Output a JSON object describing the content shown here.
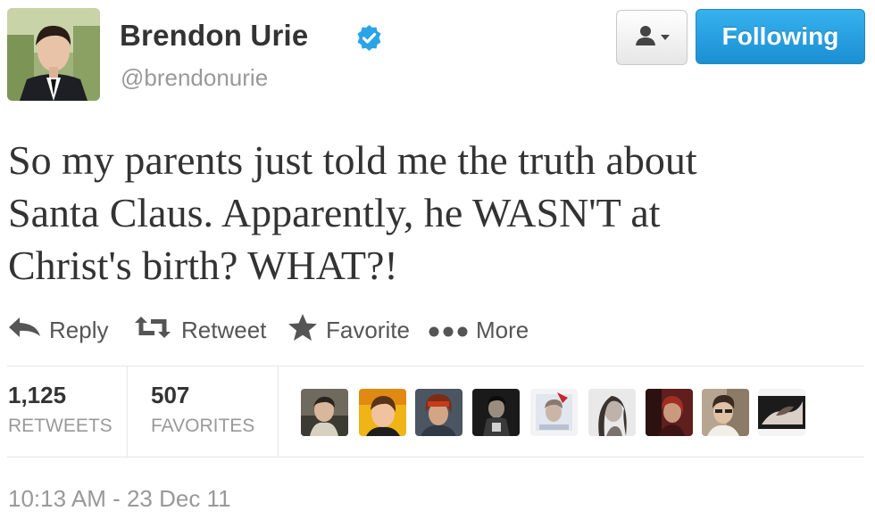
{
  "user": {
    "name": "Brendon Urie",
    "handle": "@brendonurie"
  },
  "buttons": {
    "follow_label": "Following"
  },
  "tweet": {
    "lines": [
      "So my parents just told me the truth about",
      "Santa Claus. Apparently, he WASN'T at",
      "Christ's birth? WHAT?!"
    ]
  },
  "actions": {
    "reply": "Reply",
    "retweet": "Retweet",
    "favorite": "Favorite",
    "more": "More"
  },
  "stats": {
    "retweets_count": "1,125",
    "retweets_label": "Retweets",
    "favorites_count": "507",
    "favorites_label": "Favorites"
  },
  "favoriter_avatars_count": 9,
  "timestamp": "10:13 AM - 23 Dec 11",
  "colors": {
    "accent": "#1b8fd3",
    "verified": "#2aa4e7",
    "muted_text": "#999999",
    "text": "#333333"
  }
}
